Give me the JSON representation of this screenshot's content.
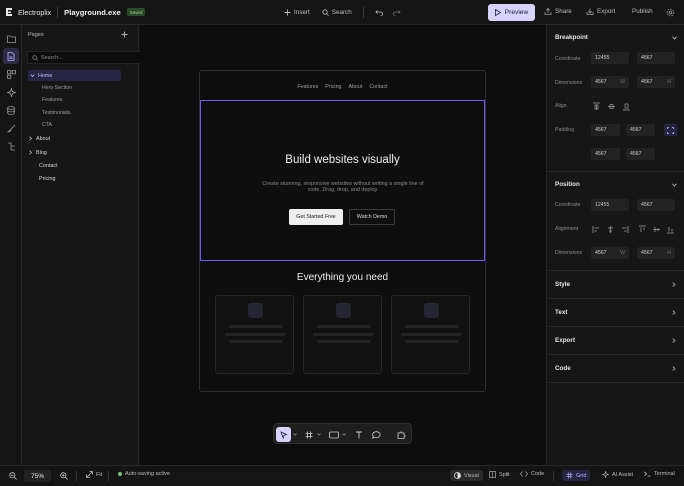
{
  "app": {
    "brand": "Electroplix",
    "filename": "Playground.exe",
    "saved_badge": "Saved"
  },
  "toolbar": {
    "insert": "Insert",
    "search": "Search",
    "preview": "Preview",
    "share": "Share",
    "export": "Export",
    "publish": "Publish"
  },
  "pages_panel": {
    "title": "Pages",
    "search_placeholder": "Search...",
    "items": [
      {
        "label": "Home",
        "expanded": true,
        "selected": true
      },
      {
        "label": "Hero Section"
      },
      {
        "label": "Features"
      },
      {
        "label": "Testimonials"
      },
      {
        "label": "CTA"
      },
      {
        "label": "About",
        "expanded": false
      },
      {
        "label": "Blog",
        "expanded": false
      },
      {
        "label": "Contact"
      },
      {
        "label": "Pricing"
      }
    ]
  },
  "preview": {
    "nav": [
      "Features",
      "Pricing",
      "About",
      "Contact"
    ],
    "hero_title": "Build websites visually",
    "hero_subtitle": "Create stunning, responsive websites without writing a single line of code. Drag, drop, and deploy.",
    "cta_primary": "Get Started Free",
    "cta_secondary": "Watch Demo",
    "features_title": "Everything you need"
  },
  "inspector": {
    "breakpoint": {
      "title": "Breakpoint",
      "coordinate_label": "Coordinate",
      "coordinate_x": "12455",
      "coordinate_y": "4567",
      "dimensions_label": "Dimensions",
      "width": "4567",
      "width_unit": "W",
      "height": "4567",
      "height_unit": "H",
      "align_label": "Align",
      "padding_label": "Padding",
      "padding": [
        "4567",
        "4567",
        "4567",
        "4567"
      ]
    },
    "position": {
      "title": "Position",
      "coordinate_label": "Coordinate",
      "coordinate_x": "12455",
      "coordinate_y": "4567",
      "alignment_label": "Alignment",
      "dimensions_label": "Dimensions",
      "width": "4567",
      "width_unit": "W",
      "height": "4567",
      "height_unit": "H"
    },
    "collapsed_sections": [
      "Style",
      "Text",
      "Export",
      "Code"
    ]
  },
  "statusbar": {
    "zoom": "75%",
    "fit": "Fit",
    "autosave": "Auto-saving active",
    "visual": "Visual",
    "split": "Split",
    "code": "Code",
    "grid": "Grid",
    "ai_assist": "AI Assist",
    "terminal": "Terminal"
  },
  "colors": {
    "accent": "#6a5cf0",
    "preview_button": "#d8d3fb",
    "saved_green": "#9ad28f"
  }
}
